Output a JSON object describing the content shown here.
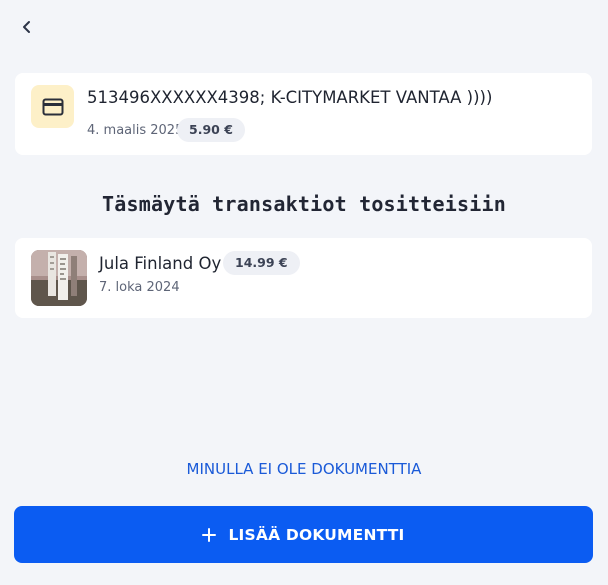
{
  "header": {
    "back_icon": "chevron-left-icon"
  },
  "transaction": {
    "icon": "credit-card-icon",
    "icon_bg_color": "#fdf0c8",
    "title": "513496XXXXXX4398; K-CITYMARKET VANTAA ))))",
    "date": "4. maalis 2025",
    "amount": "5.90 €"
  },
  "section": {
    "title": "Täsmäytä transaktiot tositteisiin"
  },
  "documents": [
    {
      "thumbnail": "receipt-photo",
      "name": "Jula Finland Oy",
      "amount": "14.99 €",
      "date": "7. loka 2024"
    }
  ],
  "actions": {
    "no_document_label": "MINULLA EI OLE DOKUMENTTIA",
    "add_document_label": "LISÄÄ DOKUMENTTI",
    "add_icon": "plus-icon",
    "primary_color": "#0b5cf2",
    "link_color": "#1a5ad8"
  }
}
